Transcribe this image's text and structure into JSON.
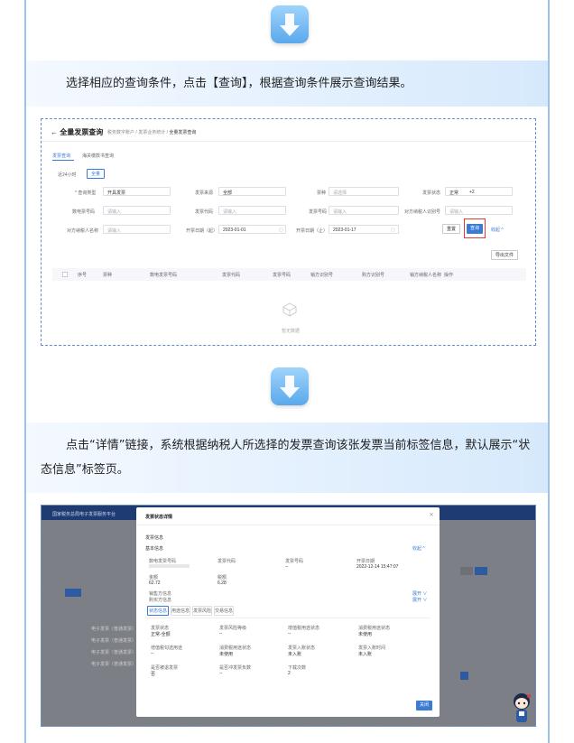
{
  "step1": {
    "instruction": "选择相应的查询条件，点击【查询】，根据查询条件展示查询结果。"
  },
  "screenshot1": {
    "title": "全量发票查询",
    "breadcrumb": [
      "税务数字账户",
      "发票业务统计",
      "全量发票查询"
    ],
    "tabs": [
      "发票查询",
      "海关缴款书查询"
    ],
    "subtabs": [
      "近24小时",
      "全量"
    ],
    "fields": [
      {
        "label": "* 查询类型",
        "value": "开具发票"
      },
      {
        "label": "发票来源",
        "value": "全部"
      },
      {
        "label": "票种",
        "value": "请选择"
      },
      {
        "label": "发票状态",
        "value": "正常"
      },
      {
        "label": "数电票号码",
        "value": "请输入"
      },
      {
        "label": "发票代码",
        "value": "请输入"
      },
      {
        "label": "发票号码",
        "value": "请输入"
      },
      {
        "label": "对方纳税人识别号",
        "value": "请输入"
      },
      {
        "label": "对方纳税人名称",
        "value": "请输入"
      },
      {
        "label": "开票日期（起）",
        "value": "2023-01-01"
      },
      {
        "label": "开票日期（止）",
        "value": "2023-01-17"
      }
    ],
    "status_extra": "+2",
    "buttons": {
      "reset": "重置",
      "query": "查询",
      "collapse": "收起"
    },
    "export": "导出文件",
    "columns": [
      "序号",
      "票种",
      "数电发票号码",
      "发票代码",
      "发票号码",
      "销方识别号",
      "购方识别号",
      "销方纳税人名称",
      "操作"
    ],
    "empty": "暂无数据"
  },
  "step2": {
    "instruction": "点击“详情”链接，系统根据纳税人所选择的发票查询该张发票当前标签信息，默认展示“状态信息”标签页。"
  },
  "screenshot2": {
    "app_title": "国家税务总局电子发票服务平台",
    "dialog_title": "发票状态详情",
    "section_title": "发票信息",
    "basic_title": "基本信息",
    "basic": [
      {
        "label": "数电发票号码",
        "value": ""
      },
      {
        "label": "发票代码",
        "value": ""
      },
      {
        "label": "发票号码",
        "value": "--"
      },
      {
        "label": "开票日期",
        "value": "2022-12-14 15:47:07"
      },
      {
        "label": "金额",
        "value": "62.72"
      },
      {
        "label": "税额",
        "value": "6.28"
      }
    ],
    "seller": "销售方信息",
    "buyer": "购买方信息",
    "expand": "展开",
    "detail_tabs": [
      "状态信息",
      "用途信息",
      "发票风险",
      "交易信息"
    ],
    "status": [
      {
        "label": "发票状态",
        "value": "正常-全额"
      },
      {
        "label": "发票风险等级",
        "value": "--"
      },
      {
        "label": "增值税用途状态",
        "value": "--"
      },
      {
        "label": "消费税用途状态",
        "value": "未使用"
      },
      {
        "label": "增值税勾选用途",
        "value": "--"
      },
      {
        "label": "消费税用途状态",
        "value": "未使用"
      },
      {
        "label": "发票入账状态",
        "value": "未入账"
      },
      {
        "label": "发票入账时间",
        "value": "未入账"
      },
      {
        "label": "是否被退发票",
        "value": "否"
      },
      {
        "label": "是否冲发票负数",
        "value": "--"
      },
      {
        "label": "下载次数",
        "value": "2"
      }
    ],
    "close_btn": "关闭",
    "bg_rows": [
      "电子发票（普通发票）",
      "电子发票（普通发票）",
      "电子发票（普通发票）",
      "电子发票（普通发票）"
    ]
  }
}
